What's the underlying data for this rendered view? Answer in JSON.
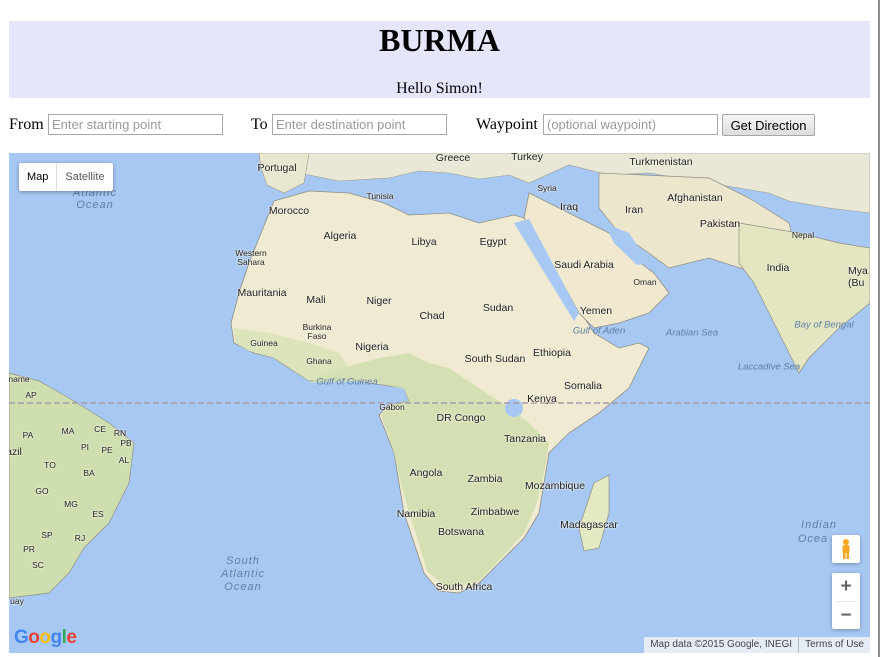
{
  "header": {
    "title": "BURMA",
    "greeting": "Hello Simon!"
  },
  "form": {
    "from_label": "From",
    "from_placeholder": "Enter starting point",
    "to_label": "To",
    "to_placeholder": "Enter destination point",
    "waypoint_label": "Waypoint",
    "waypoint_placeholder": "(optional waypoint)",
    "submit_label": "Get Direction"
  },
  "map": {
    "map_type": {
      "map_label": "Map",
      "satellite_label": "Satellite",
      "selected": "Map"
    },
    "countries": {
      "portugal": "Portugal",
      "greece": "Greece",
      "turkey": "Turkey",
      "turkmenistan": "Turkmenistan",
      "tunisia": "Tunisia",
      "syria": "Syria",
      "iraq": "Iraq",
      "iran": "Iran",
      "afghanistan": "Afghanistan",
      "pakistan": "Pakistan",
      "nepal": "Nepal",
      "india": "India",
      "myanmar": "Mya (Bu",
      "morocco": "Morocco",
      "algeria": "Algeria",
      "libya": "Libya",
      "egypt": "Egypt",
      "saudi_arabia": "Saudi Arabia",
      "oman": "Oman",
      "yemen": "Yemen",
      "western_sahara": "Western Sahara",
      "mauritania": "Mauritania",
      "mali": "Mali",
      "niger": "Niger",
      "chad": "Chad",
      "sudan": "Sudan",
      "burkina_faso": "Burkina Faso",
      "guinea": "Guinea",
      "ghana": "Ghana",
      "nigeria": "Nigeria",
      "south_sudan": "South Sudan",
      "ethiopia": "Ethiopia",
      "somalia": "Somalia",
      "gabon": "Gabon",
      "dr_congo": "DR Congo",
      "kenya": "Kenya",
      "tanzania": "Tanzania",
      "angola": "Angola",
      "zambia": "Zambia",
      "mozambique": "Mozambique",
      "madagascar": "Madagascar",
      "namibia": "Namibia",
      "zimbabwe": "Zimbabwe",
      "botswana": "Botswana",
      "south_africa": "South Africa",
      "suriname_partial": "name",
      "ap": "AP",
      "pa": "PA",
      "ma": "MA",
      "ce": "CE",
      "rn": "RN",
      "pi": "PI",
      "pb": "PB",
      "pe": "PE",
      "al": "AL",
      "brazil_partial": "azil",
      "to": "TO",
      "ba": "BA",
      "go": "GO",
      "mg": "MG",
      "es": "ES",
      "sp": "SP",
      "rj": "RJ",
      "pr": "PR",
      "sc": "SC",
      "uruguay_partial": "uay"
    },
    "waters": {
      "atlantic_n": "Atlantic",
      "ocean_n": "Ocean",
      "south_atlantic_1": "South",
      "south_atlantic_2": "Atlantic",
      "south_atlantic_3": "Ocean",
      "indian_1": "Indian",
      "indian_2": "Ocea",
      "gulf_aden": "Gulf of Aden",
      "arabian_sea": "Arabian Sea",
      "bay_bengal": "Bay of Bengal",
      "laccadive": "Laccadive Sea",
      "gulf_guinea": "Gulf of Guinea"
    },
    "zoom_in": "+",
    "zoom_out": "−",
    "logo": "Google",
    "logo_colors": [
      "#4285f4",
      "#ea4335",
      "#fbbc05",
      "#4285f4",
      "#34a853",
      "#ea4335"
    ],
    "attribution": "Map data ©2015 Google, INEGI",
    "terms": "Terms of Use"
  },
  "colors": {
    "header_bg": "#e6e6fa",
    "water": "#a8c8f4",
    "land": "#f0edd8",
    "green_land": "#c9dba6"
  }
}
